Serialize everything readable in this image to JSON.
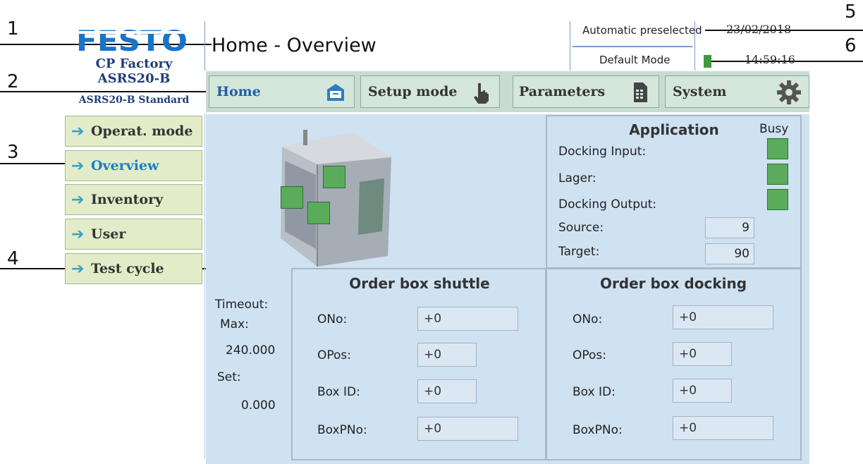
{
  "callouts": [
    "1",
    "2",
    "3",
    "4",
    "5",
    "6"
  ],
  "brand": {
    "logo": "FESTO",
    "line1": "CP Factory",
    "line2": "ASRS20-B",
    "line3": "ASRS20-B Standard"
  },
  "page_title": "Home - Overview",
  "header": {
    "mode_status": "Automatic preselected",
    "date": "23/02/2018",
    "mode_name": "Default Mode",
    "time": "14:59:16",
    "mode_indicator_color": "#3f9a3f"
  },
  "nav": {
    "tabs": [
      {
        "label": "Home",
        "icon": "cabinet-icon",
        "active": true
      },
      {
        "label": "Setup mode",
        "icon": "hand-pointer-icon"
      },
      {
        "label": "Parameters",
        "icon": "document-icon"
      },
      {
        "label": "System",
        "icon": "gear-icon"
      }
    ]
  },
  "sidebar": {
    "items": [
      {
        "label": "Operat. mode"
      },
      {
        "label": "Overview",
        "active": true
      },
      {
        "label": "Inventory"
      },
      {
        "label": "User"
      },
      {
        "label": "Test cycle"
      }
    ]
  },
  "machine_image": "asrs-machine-3d-image",
  "timeout": {
    "title": "Timeout:",
    "max_label": "Max:",
    "max_value": "240.000",
    "set_label": "Set:",
    "set_value": "0.000"
  },
  "application": {
    "title": "Application",
    "busy_label": "Busy",
    "rows": [
      "Docking Input:",
      "Lager:",
      "Docking Output:"
    ],
    "source_label": "Source:",
    "source_value": "9",
    "target_label": "Target:",
    "target_value": "90",
    "indicator_color": "#5aac5a"
  },
  "order_shuttle": {
    "title": "Order box shuttle",
    "rows": [
      {
        "label": "ONo:",
        "value": "+0"
      },
      {
        "label": "OPos:",
        "value": "+0"
      },
      {
        "label": "Box ID:",
        "value": "+0"
      },
      {
        "label": "BoxPNo:",
        "value": "+0"
      }
    ]
  },
  "order_docking": {
    "title": "Order box docking",
    "rows": [
      {
        "label": "ONo:",
        "value": "+0"
      },
      {
        "label": "OPos:",
        "value": "+0"
      },
      {
        "label": "Box ID:",
        "value": "+0"
      },
      {
        "label": "BoxPNo:",
        "value": "+0"
      }
    ]
  }
}
